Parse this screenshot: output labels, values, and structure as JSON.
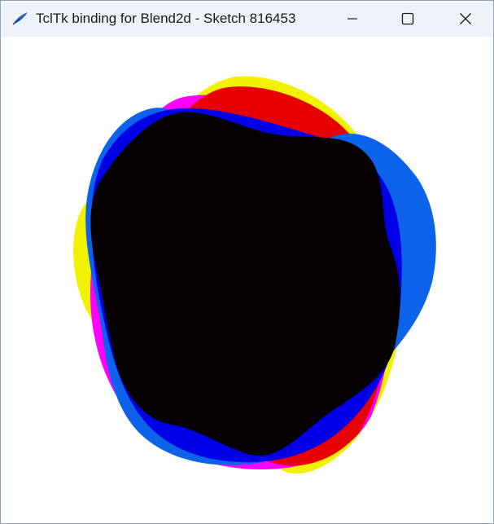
{
  "window": {
    "title": "TclTk binding for Blend2d - Sketch 816453",
    "controls": {
      "minimize_icon": "minimize-icon",
      "maximize_icon": "maximize-icon",
      "close_icon": "close-icon"
    }
  },
  "sketch": {
    "background": "#ffffff",
    "blobs": [
      {
        "name": "yellow-blob",
        "color": "#f2f200"
      },
      {
        "name": "magenta-blob",
        "color": "#ff00ff"
      },
      {
        "name": "red-blob",
        "color": "#e60000"
      },
      {
        "name": "blue-blob",
        "color": "#0c63ea"
      },
      {
        "name": "dark-blue-blob",
        "color": "#0000e6"
      },
      {
        "name": "black-blob",
        "color": "#060000"
      }
    ]
  }
}
